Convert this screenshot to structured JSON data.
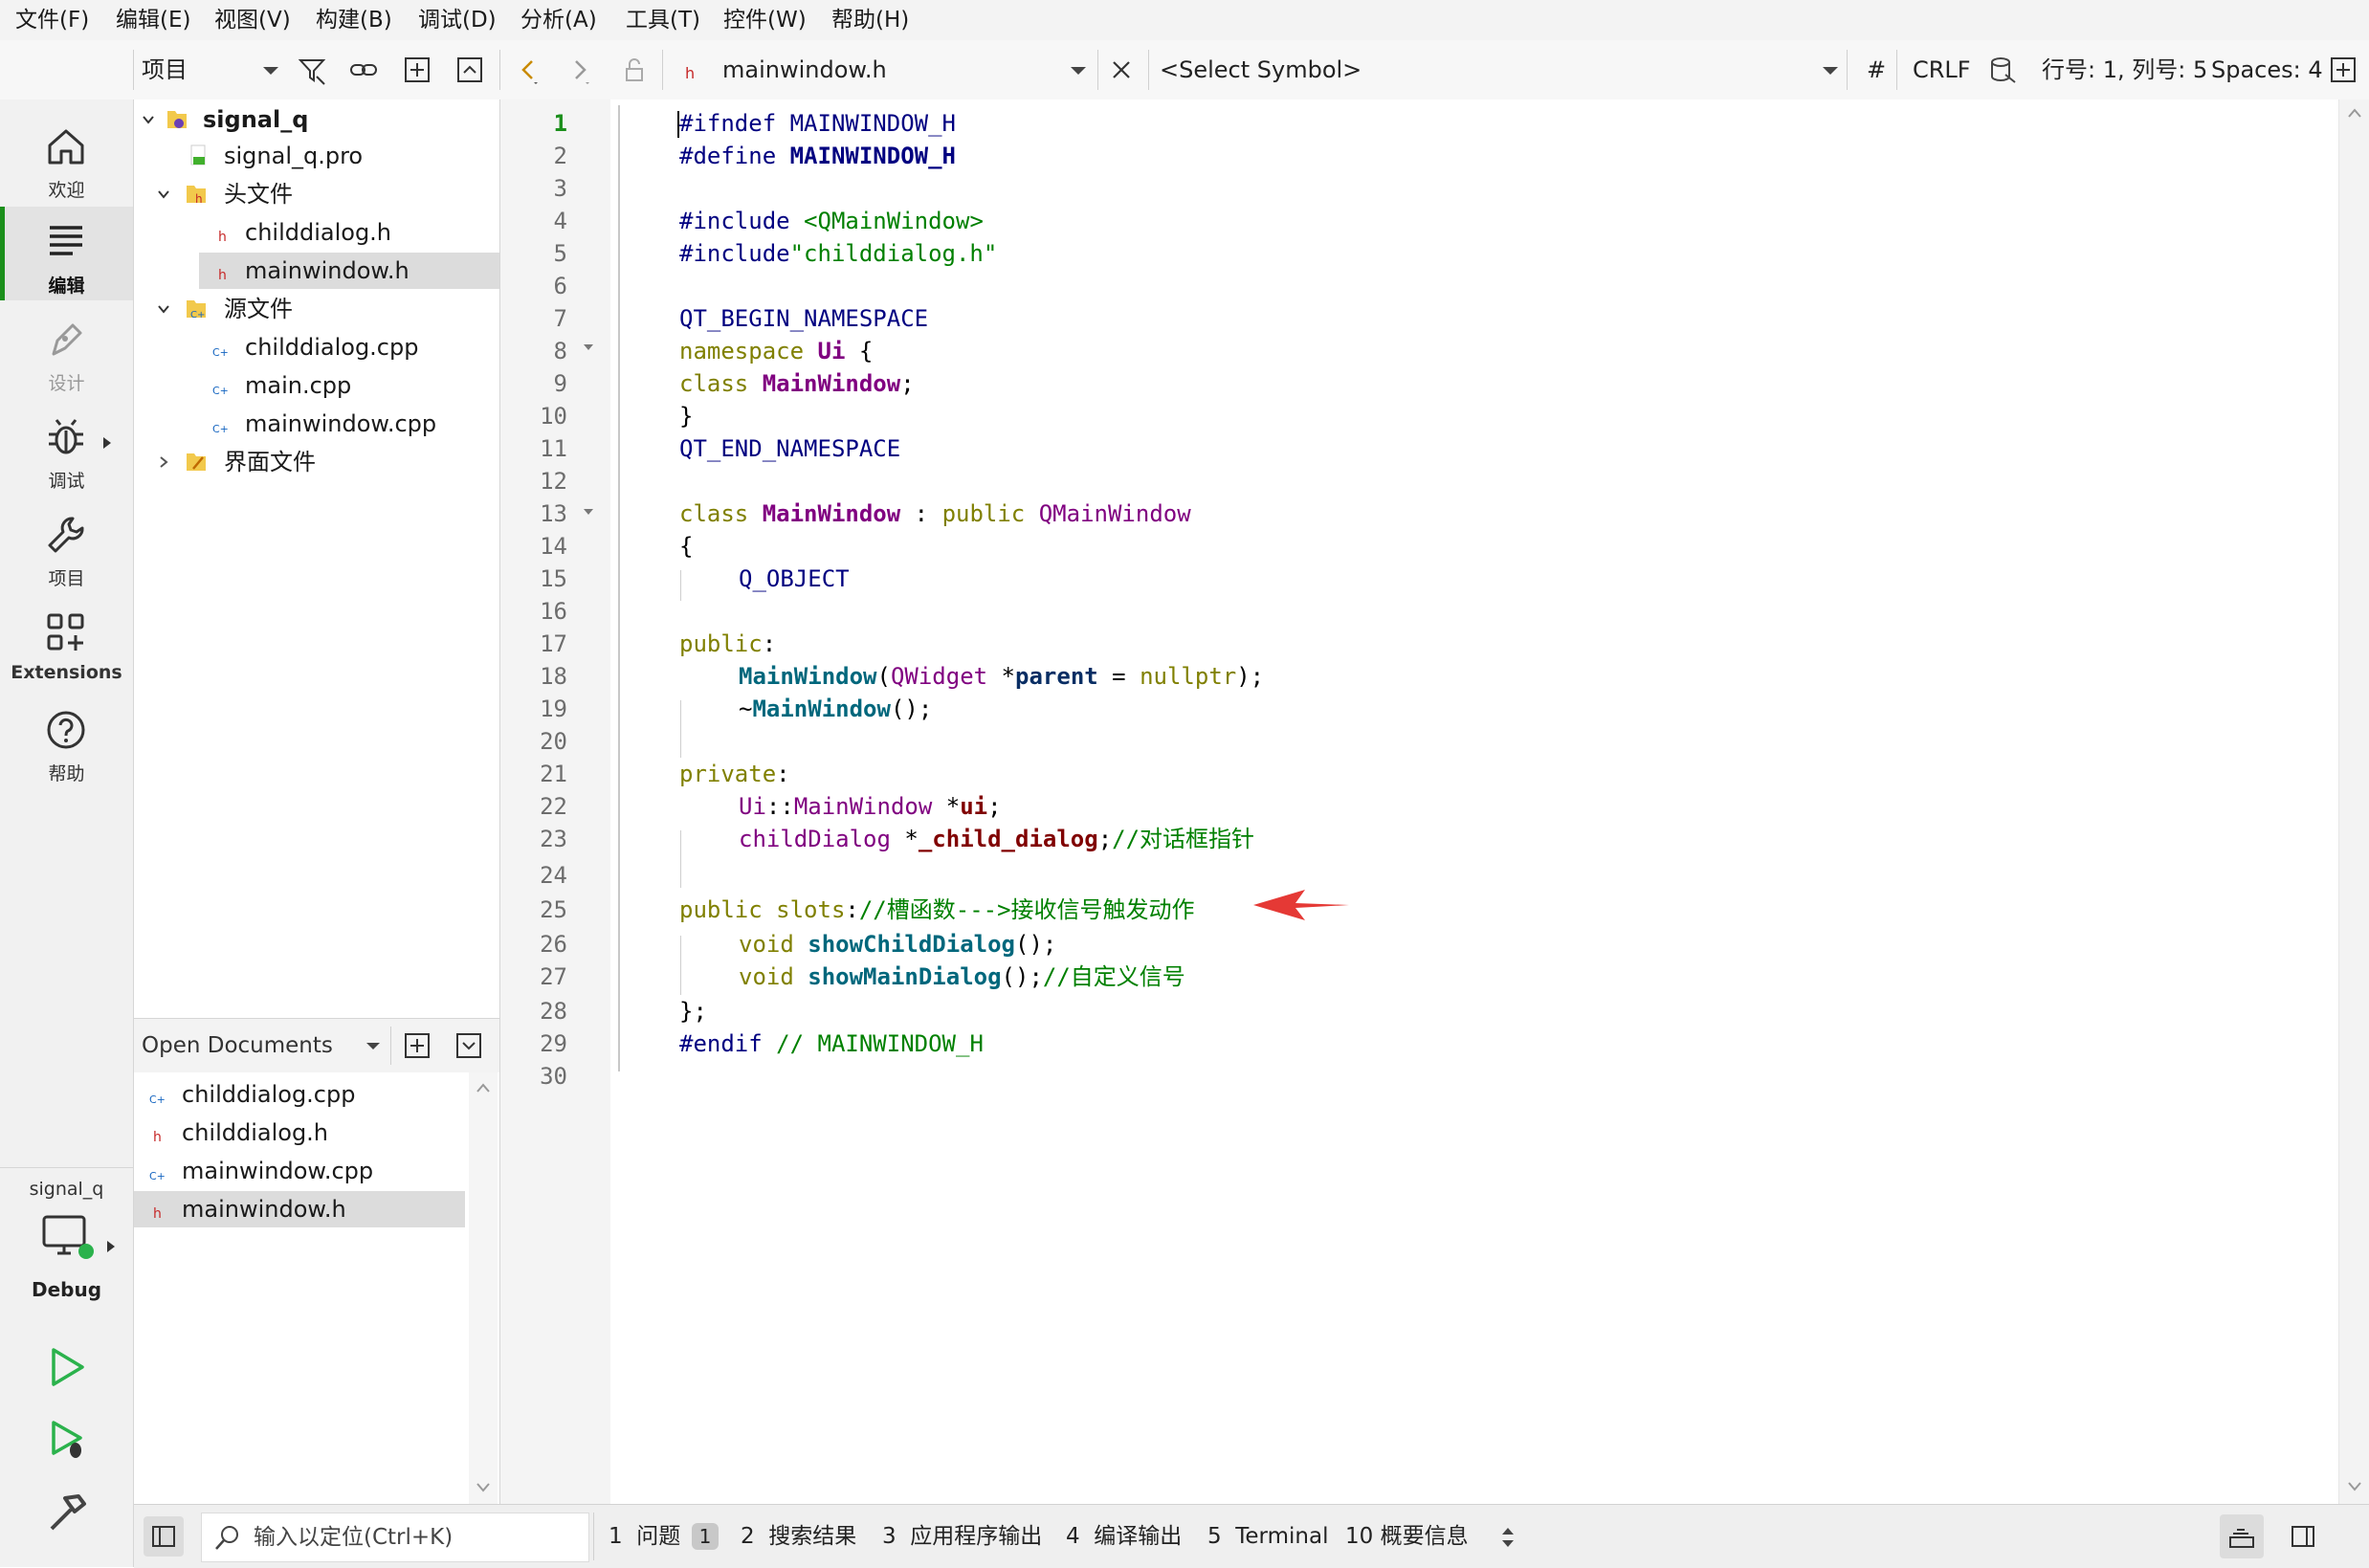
{
  "menu": [
    "文件(F)",
    "编辑(E)",
    "视图(V)",
    "构建(B)",
    "调试(D)",
    "分析(A)",
    "工具(T)",
    "控件(W)",
    "帮助(H)"
  ],
  "toolbar": {
    "project_combo": "项目",
    "file_name": "mainwindow.h",
    "symbol": "<Select Symbol>",
    "hash": "#",
    "line_ending": "CRLF",
    "cursor_pos": "行号: 1, 列号: 5",
    "spaces": "Spaces: 4"
  },
  "modes": [
    {
      "label": "欢迎",
      "icon": "home-icon"
    },
    {
      "label": "编辑",
      "icon": "edit-icon"
    },
    {
      "label": "设计",
      "icon": "design-icon"
    },
    {
      "label": "调试",
      "icon": "debug-icon"
    },
    {
      "label": "项目",
      "icon": "wrench-icon"
    },
    {
      "label": "Extensions",
      "icon": "extensions-icon"
    },
    {
      "label": "帮助",
      "icon": "help-icon"
    }
  ],
  "kit": {
    "project": "signal_q",
    "config": "Debug"
  },
  "tree": [
    {
      "label": "signal_q",
      "level": 0,
      "type": "project",
      "expanded": true
    },
    {
      "label": "signal_q.pro",
      "level": 1,
      "type": "pro"
    },
    {
      "label": "头文件",
      "level": 1,
      "type": "folder-h",
      "expanded": true
    },
    {
      "label": "childdialog.h",
      "level": 2,
      "type": "h"
    },
    {
      "label": "mainwindow.h",
      "level": 2,
      "type": "h",
      "selected": true
    },
    {
      "label": "源文件",
      "level": 1,
      "type": "folder-cpp",
      "expanded": true
    },
    {
      "label": "childdialog.cpp",
      "level": 2,
      "type": "cpp"
    },
    {
      "label": "main.cpp",
      "level": 2,
      "type": "cpp"
    },
    {
      "label": "mainwindow.cpp",
      "level": 2,
      "type": "cpp"
    },
    {
      "label": "界面文件",
      "level": 1,
      "type": "folder-ui",
      "expanded": false
    }
  ],
  "open_documents": {
    "title": "Open Documents",
    "items": [
      {
        "label": "childdialog.cpp",
        "type": "cpp"
      },
      {
        "label": "childdialog.h",
        "type": "h"
      },
      {
        "label": "mainwindow.cpp",
        "type": "cpp"
      },
      {
        "label": "mainwindow.h",
        "type": "h",
        "selected": true
      }
    ]
  },
  "line_numbers": [
    "1",
    "2",
    "3",
    "4",
    "5",
    "6",
    "7",
    "8",
    "9",
    "10",
    "11",
    "12",
    "13",
    "14",
    "15",
    "16",
    "17",
    "18",
    "19",
    "20",
    "21",
    "22",
    "23",
    "24",
    "25",
    "26",
    "27",
    "28",
    "29",
    "30"
  ],
  "code": {
    "l1a": "#ifndef ",
    "l1b": "MAINWINDOW_H",
    "l2a": "#define ",
    "l2b": "MAINWINDOW_H",
    "l4a": "#include ",
    "l4b": "<QMainWindow>",
    "l5a": "#include",
    "l5b": "\"childdialog.h\"",
    "l7": "QT_BEGIN_NAMESPACE",
    "l8a": "namespace ",
    "l8b": "Ui",
    "l8c": " {",
    "l9a": "class ",
    "l9b": "MainWindow",
    "l9c": ";",
    "l10": "}",
    "l11": "QT_END_NAMESPACE",
    "l13a": "class ",
    "l13b": "MainWindow",
    "l13c": " : ",
    "l13d": "public ",
    "l13e": "QMainWindow",
    "l14": "{",
    "l15": "Q_OBJECT",
    "l17a": "public",
    "l17b": ":",
    "l18a": "MainWindow",
    "l18b": "(",
    "l18c": "QWidget",
    "l18d": " *",
    "l18e": "parent",
    "l18f": " = ",
    "l18g": "nullptr",
    "l18h": ");",
    "l19a": "~",
    "l19b": "MainWindow",
    "l19c": "();",
    "l21a": "private",
    "l21b": ":",
    "l22a": "Ui",
    "l22b": "::",
    "l22c": "MainWindow",
    "l22d": " *",
    "l22e": "ui",
    "l22f": ";",
    "l23a": "childDialog",
    "l23b": " *",
    "l23c": "_child_dialog",
    "l23d": ";",
    "l23e": "//对话框指针",
    "l25a": "public ",
    "l25b": "slots",
    "l25c": ":",
    "l25d": "//槽函数--->接收信号触发动作",
    "l26a": "void ",
    "l26b": "showChildDialog",
    "l26c": "();",
    "l27a": "void ",
    "l27b": "showMainDialog",
    "l27c": "();",
    "l27d": "//自定义信号",
    "l28": "};",
    "l29a": "#endif ",
    "l29b": "// MAINWINDOW_H"
  },
  "statusbar": {
    "locator_placeholder": "输入以定位(Ctrl+K)",
    "tabs": [
      {
        "num": "1",
        "label": "问题",
        "badge": "1"
      },
      {
        "num": "2",
        "label": "搜索结果"
      },
      {
        "num": "3",
        "label": "应用程序输出"
      },
      {
        "num": "4",
        "label": "编译输出"
      },
      {
        "num": "5",
        "label": "Terminal"
      },
      {
        "num": "10",
        "label": "概要信息"
      }
    ]
  },
  "colors": {
    "accent_green": "#1b8f1b",
    "arrow_red": "#e53935",
    "selection": "#dcdcdc"
  }
}
